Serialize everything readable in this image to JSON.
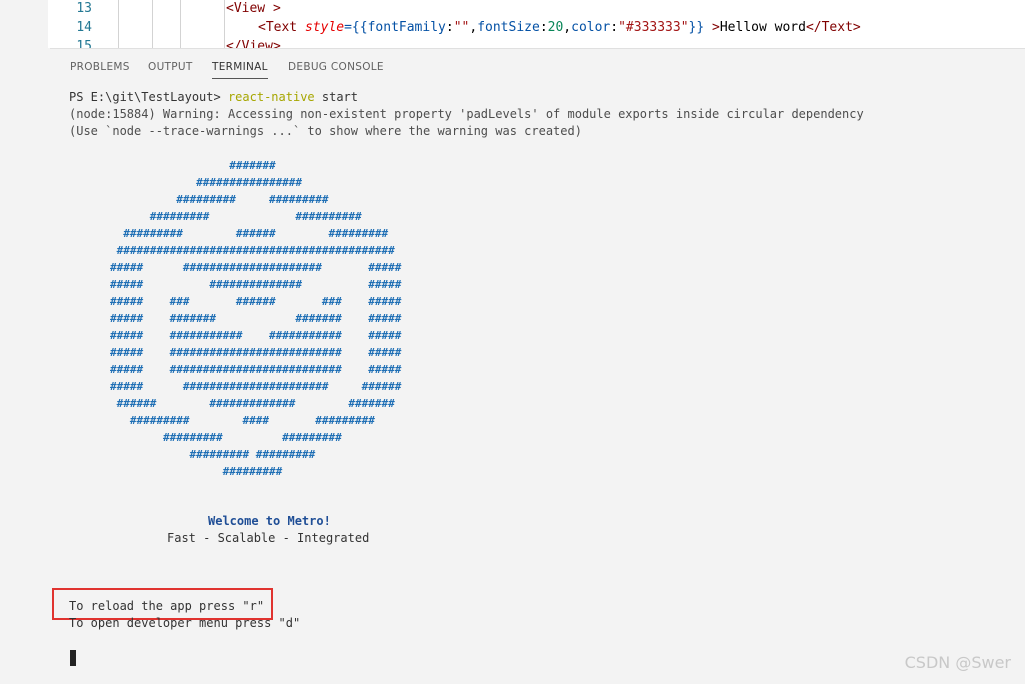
{
  "editor": {
    "lines": [
      {
        "num": "13",
        "indent": "",
        "content": [
          {
            "t": "<",
            "c": "punc"
          },
          {
            "t": "View",
            "c": "tag"
          },
          {
            "t": " >",
            "c": "punc"
          }
        ]
      },
      {
        "num": "14",
        "indent": "    ",
        "content": [
          {
            "t": "<",
            "c": "punc"
          },
          {
            "t": "Text",
            "c": "tag"
          },
          {
            "t": " ",
            "c": ""
          },
          {
            "t": "style",
            "c": "attr"
          },
          {
            "t": "={{",
            "c": "key"
          },
          {
            "t": "fontFamily",
            "c": "key"
          },
          {
            "t": ":",
            "c": ""
          },
          {
            "t": "\"\"",
            "c": "str"
          },
          {
            "t": ",",
            "c": ""
          },
          {
            "t": "fontSize",
            "c": "key"
          },
          {
            "t": ":",
            "c": ""
          },
          {
            "t": "20",
            "c": "green"
          },
          {
            "t": ",",
            "c": ""
          },
          {
            "t": "color",
            "c": "key"
          },
          {
            "t": ":",
            "c": ""
          },
          {
            "t": "\"#333333\"",
            "c": "str"
          },
          {
            "t": "}} ",
            "c": "key"
          },
          {
            "t": ">",
            "c": "punc"
          },
          {
            "t": "Hellow word",
            "c": ""
          },
          {
            "t": "</",
            "c": "punc"
          },
          {
            "t": "Text",
            "c": "tag"
          },
          {
            "t": ">",
            "c": "punc"
          }
        ]
      },
      {
        "num": "15",
        "indent": "",
        "content": [
          {
            "t": "</",
            "c": "punc"
          },
          {
            "t": "View",
            "c": "tag"
          },
          {
            "t": ">",
            "c": "punc"
          }
        ]
      }
    ]
  },
  "panel": {
    "tabs": [
      "PROBLEMS",
      "OUTPUT",
      "TERMINAL",
      "DEBUG CONSOLE"
    ],
    "active_tab": "TERMINAL"
  },
  "terminal": {
    "prompt": "PS E:\\git\\TestLayout> ",
    "command": "react-native",
    "args": " start",
    "warning1": "(node:15884) Warning: Accessing non-existent property 'padLevels' of module exports inside circular dependency",
    "warning2": "(Use `node --trace-warnings ...` to show where the warning was created)",
    "logo": "                  #######\n             ################\n          #########     #########\n      #########             ##########\n  #########        ######        #########\n ##########################################\n#####      #####################       #####\n#####          ##############          #####\n#####    ###       ######       ###    #####\n#####    #######            #######    #####\n#####    ###########    ###########    #####\n#####    ##########################    #####\n#####    ##########################    #####\n#####      ######################     ######\n ######        #############        #######\n   #########        ####       #########\n        #########         #########\n            ######### #########\n                 #########",
    "welcome": "Welcome to Metro!",
    "tagline": "Fast - Scalable - Integrated",
    "hint_reload": "To reload the app press \"r\"",
    "hint_dev": "To open developer menu press \"d\""
  },
  "watermark": "CSDN @Swer",
  "colors": {
    "highlight_box": "#e0332f",
    "logo": "#1f6fb5",
    "command": "#a6a600"
  }
}
